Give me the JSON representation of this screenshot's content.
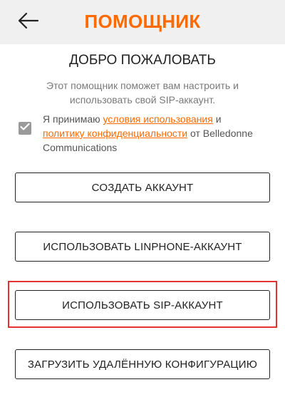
{
  "header": {
    "title": "ПОМОЩНИК",
    "back_icon": "arrow-left-icon"
  },
  "welcome": {
    "heading": "ДОБРО ПОЖАЛОВАТЬ",
    "description": "Этот помощник поможет вам настроить и использовать свой SIP-аккаунт."
  },
  "terms": {
    "checked": true,
    "prefix": "Я принимаю ",
    "terms_link": "условия использования",
    "and": " и",
    "privacy_link": "политику конфиденциальности",
    "suffix": " от Belledonne Communications"
  },
  "buttons": {
    "create_account": "СОЗДАТЬ АККАУНТ",
    "use_linphone": "ИСПОЛЬЗОВАТЬ LINPHONE-АККАУНТ",
    "use_sip": "ИСПОЛЬЗОВАТЬ SIP-АККАУНТ",
    "remote_config": "ЗАГРУЗИТЬ УДАЛЁННУЮ КОНФИГУРАЦИЮ"
  },
  "colors": {
    "accent": "#fe6a00",
    "topbar": "#f0f0f0",
    "highlight": "#e23232"
  }
}
